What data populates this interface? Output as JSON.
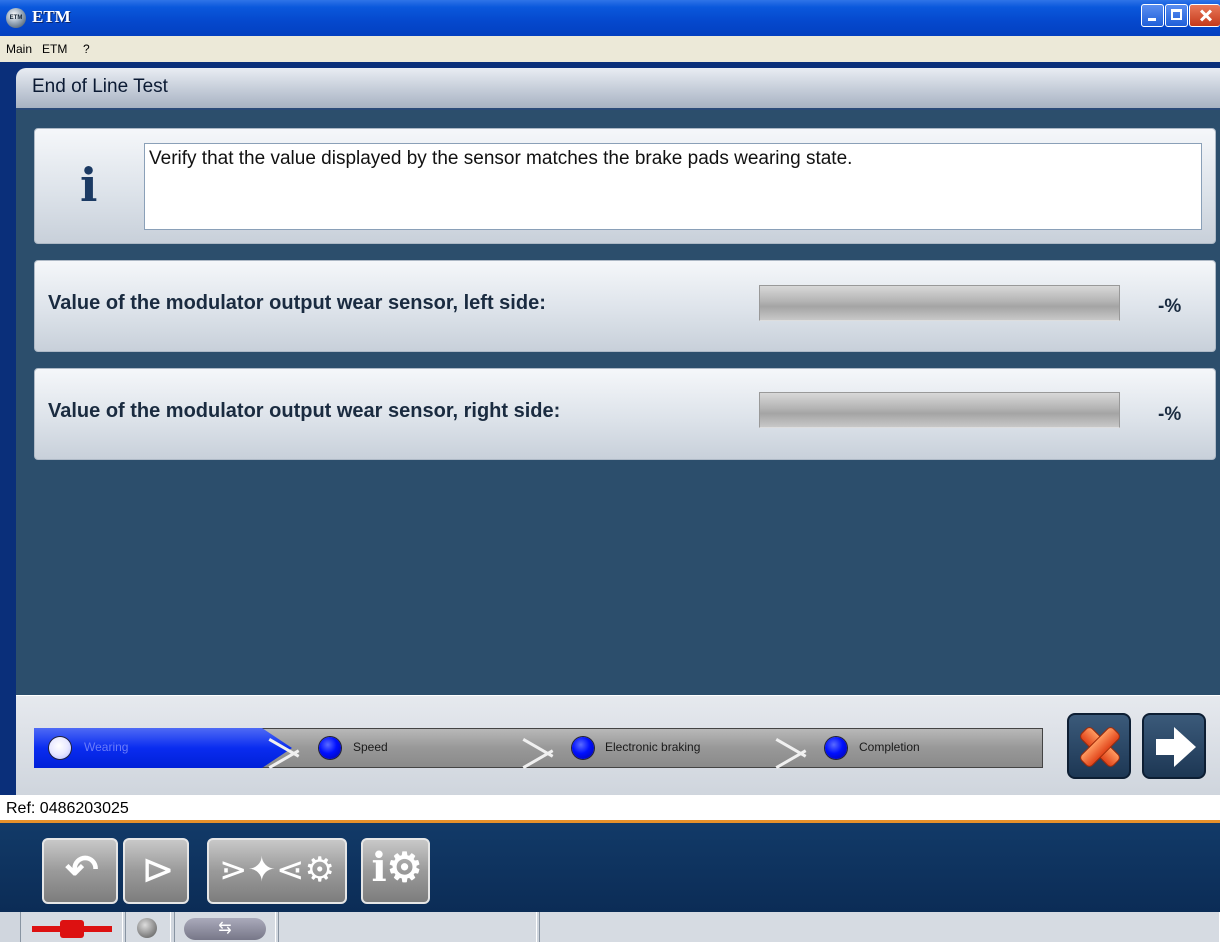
{
  "window": {
    "title": "ETM",
    "app_icon_text": "ETM"
  },
  "menu": [
    "Main",
    "ETM",
    "?"
  ],
  "header": {
    "title": "End of Line Test"
  },
  "info": {
    "message": "Verify that the value displayed by the sensor matches the brake pads wearing state."
  },
  "sensors": [
    {
      "label": "Value of the modulator output wear sensor, left side:",
      "value_text": "-%",
      "fill_fraction": 0
    },
    {
      "label": "Value of the modulator output wear sensor, right side:",
      "value_text": "-%",
      "fill_fraction": 0
    }
  ],
  "steps": [
    {
      "label": "Wearing",
      "state": "active"
    },
    {
      "label": "Speed",
      "state": "pending"
    },
    {
      "label": "Electronic braking",
      "state": "pending"
    },
    {
      "label": "Completion",
      "state": "pending"
    }
  ],
  "ref": "Ref: 0486203025",
  "colors": {
    "frame": "#0a2f7a",
    "content_bg": "#2c4e6c",
    "step_active": "#0a2cf0",
    "accent_line": "#e8912b",
    "cancel": "#e1441a"
  }
}
